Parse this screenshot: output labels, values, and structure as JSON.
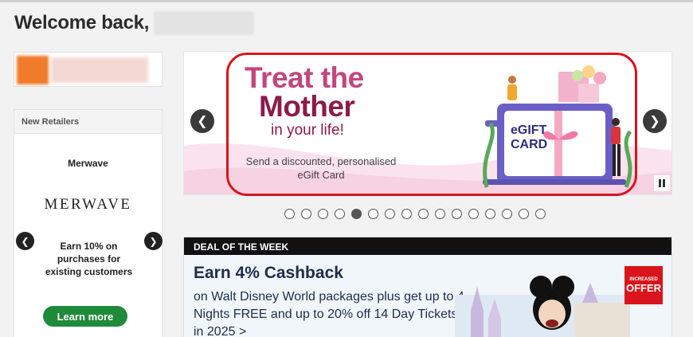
{
  "header": {
    "welcome_text": "Welcome back,"
  },
  "sidebar": {
    "new_retailers": {
      "title": "New Retailers",
      "retailer_name": "Merwave",
      "retailer_logo": "MERWAVE",
      "offer": "Earn 10% on purchases for existing customers",
      "cta": "Learn more",
      "prev_icon": "chevron-left-icon",
      "next_icon": "chevron-right-icon"
    }
  },
  "carousel": {
    "headline_line1": "Treat the",
    "headline_line2": "Mother",
    "headline_line3": "in your life!",
    "subtext": "Send a discounted, personalised eGift Card",
    "card_text_line1": "eGIFT",
    "card_text_line2": "CARD",
    "dot_count": 16,
    "active_index": 4,
    "prev_icon": "chevron-left-icon",
    "next_icon": "chevron-right-icon",
    "pause_icon": "pause-icon"
  },
  "deal": {
    "bar_label": "DEAL OF THE WEEK",
    "title": "Earn 4% Cashback",
    "description": "on Walt Disney World packages plus get up to 4 Nights FREE and up to 20% off 14 Day Tickets in 2025 >",
    "badge_line1": "INCREASED",
    "badge_line2": "OFFER"
  },
  "colors": {
    "accent_orange": "#f07b2a",
    "treat_pink": "#c3467d",
    "mother_plum": "#8c1b49",
    "learn_more_green": "#1f8a3a",
    "highlight_red": "#d8141f",
    "badge_red": "#d9141c"
  }
}
